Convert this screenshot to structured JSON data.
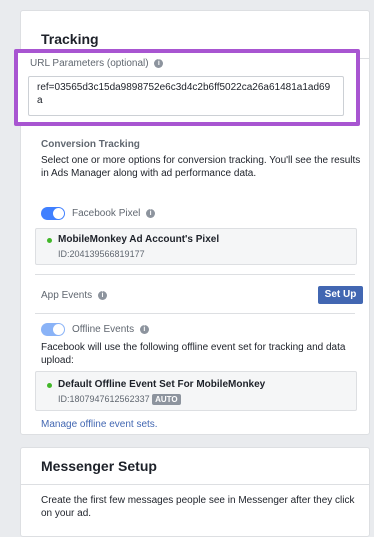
{
  "tracking": {
    "title": "Tracking",
    "url_params": {
      "label": "URL Parameters (optional)",
      "info_icon": "info-icon",
      "value": "ref=03565d3c15da9898752e6c3d4c2b6ff5022ca26a61481a1ad69a"
    },
    "conversion": {
      "title": "Conversion Tracking",
      "description": "Select one or more options for conversion tracking. You'll see the results in Ads Manager along with ad performance data.",
      "facebook_pixel": {
        "label": "Facebook Pixel",
        "enabled": true,
        "name": "MobileMonkey Ad Account's Pixel",
        "id": "ID:204139566819177"
      },
      "app_events": {
        "label": "App Events",
        "button": "Set Up"
      },
      "offline_events": {
        "label": "Offline Events",
        "enabled": true,
        "description": "Facebook will use the following offline event set for tracking and data upload:",
        "set_name": "Default Offline Event Set For MobileMonkey",
        "set_id": "ID:1807947612562337",
        "badge": "AUTO"
      },
      "manage_link": "Manage offline event sets."
    }
  },
  "messenger": {
    "title": "Messenger Setup",
    "description": "Create the first few messages people see in Messenger after they click on your ad."
  },
  "colors": {
    "accent": "#4267b2",
    "highlight_border": "#a855d1",
    "toggle_on": "#4080ff",
    "status_dot": "#42b72a"
  }
}
